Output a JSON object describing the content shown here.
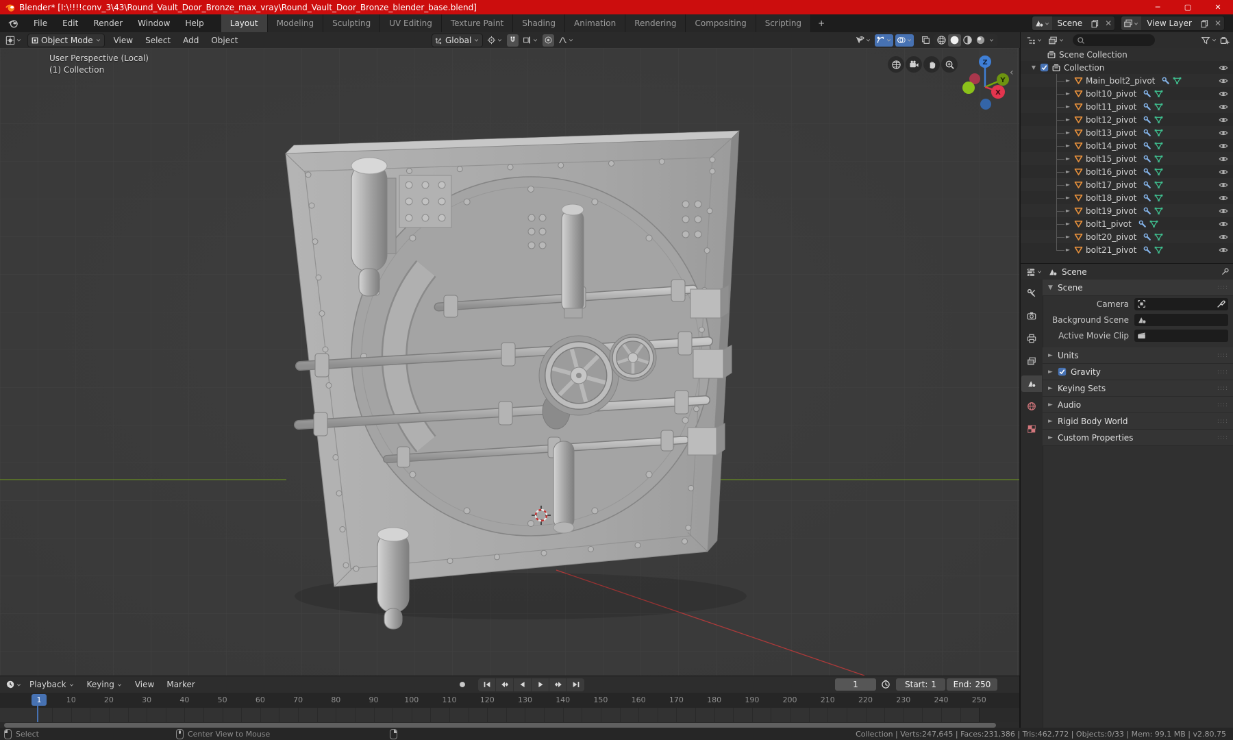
{
  "window": {
    "title": "Blender* [I:\\!!!!conv_3\\43\\Round_Vault_Door_Bronze_max_vray\\Round_Vault_Door_Bronze_blender_base.blend]"
  },
  "topbar": {
    "app_menus": [
      "File",
      "Edit",
      "Render",
      "Window",
      "Help"
    ],
    "workspaces": [
      "Layout",
      "Modeling",
      "Sculpting",
      "UV Editing",
      "Texture Paint",
      "Shading",
      "Animation",
      "Rendering",
      "Compositing",
      "Scripting"
    ],
    "active_workspace": "Layout",
    "new_workspace_label": "+",
    "scene": {
      "value": "Scene"
    },
    "view_layer": {
      "value": "View Layer"
    }
  },
  "viewport_header": {
    "mode": "Object Mode",
    "menus": [
      "View",
      "Select",
      "Add",
      "Object"
    ],
    "orientation": "Global",
    "shading_modes": [
      "wireframe",
      "solid",
      "material-preview",
      "rendered"
    ],
    "active_shading": "solid"
  },
  "outliner": {
    "root_label": "Scene Collection",
    "collection_label": "Collection",
    "objects": [
      "Main_bolt2_pivot",
      "bolt10_pivot",
      "bolt11_pivot",
      "bolt12_pivot",
      "bolt13_pivot",
      "bolt14_pivot",
      "bolt15_pivot",
      "bolt16_pivot",
      "bolt17_pivot",
      "bolt18_pivot",
      "bolt19_pivot",
      "bolt1_pivot",
      "bolt20_pivot",
      "bolt21_pivot"
    ],
    "object_icons": [
      "mesh-icon",
      "modifier-wrench-icon",
      "mesh-data-icon",
      "eye-icon"
    ]
  },
  "properties": {
    "breadcrumb": "Scene",
    "tabs": [
      "tool",
      "render",
      "output",
      "view-layer",
      "scene",
      "world",
      "texture"
    ],
    "active_tab": "scene",
    "scene_panel": {
      "label": "Scene",
      "fields": [
        {
          "label": "Camera",
          "icon": "camera-data-icon",
          "has_eyedropper": true
        },
        {
          "label": "Background Scene",
          "icon": "scene-icon",
          "has_eyedropper": false
        },
        {
          "label": "Active Movie Clip",
          "icon": "movie-clip-icon",
          "has_eyedropper": false
        }
      ]
    },
    "collapsed_panels": [
      {
        "label": "Units",
        "checkbox": false
      },
      {
        "label": "Gravity",
        "checkbox": true,
        "checked": true
      },
      {
        "label": "Keying Sets",
        "checkbox": false
      },
      {
        "label": "Audio",
        "checkbox": false
      },
      {
        "label": "Rigid Body World",
        "checkbox": false
      },
      {
        "label": "Custom Properties",
        "checkbox": false
      }
    ]
  },
  "viewport": {
    "overlay_line1": "User Perspective (Local)",
    "overlay_line2": "(1) Collection",
    "axis_labels": {
      "x": "X",
      "y": "Y",
      "z": "Z"
    },
    "nav_buttons": [
      "orthographic-grid-icon",
      "camera-view-icon",
      "pan-hand-icon",
      "zoom-icon"
    ]
  },
  "timeline": {
    "menus": [
      "Playback",
      "Keying",
      "View",
      "Marker"
    ],
    "menus_with_caret": [
      "Playback",
      "Keying"
    ],
    "transport": [
      "jump-start",
      "prev-keyframe",
      "play-reverse",
      "play",
      "next-keyframe",
      "jump-end"
    ],
    "current_frame": "1",
    "first_frame_label": "1",
    "ticks": [
      10,
      20,
      30,
      40,
      50,
      60,
      70,
      80,
      90,
      100,
      110,
      120,
      130,
      140,
      150,
      160,
      170,
      180,
      190,
      200,
      210,
      220,
      230,
      240,
      250
    ],
    "frame_start": 1,
    "frame_end": 250,
    "start_label": "Start:",
    "start_value": "1",
    "end_label": "End:",
    "end_value": "250"
  },
  "status_bar": {
    "hint_select": "Select",
    "hint_center": "Center View to Mouse",
    "stats": "Collection | Verts:247,645 | Faces:231,386 | Tris:462,772 | Objects:0/33 | Mem: 99.1 MB | v2.80.75"
  },
  "colors": {
    "title_red": "#cc0d0d",
    "accent_blue": "#4772b3",
    "mesh_orange": "#e8913c",
    "data_green": "#3fbf8f",
    "modifier_blue": "#84b3e8",
    "axis_x_red": "#e3354e",
    "axis_y_green": "#77a80a",
    "axis_z_blue": "#3f7fd6"
  }
}
